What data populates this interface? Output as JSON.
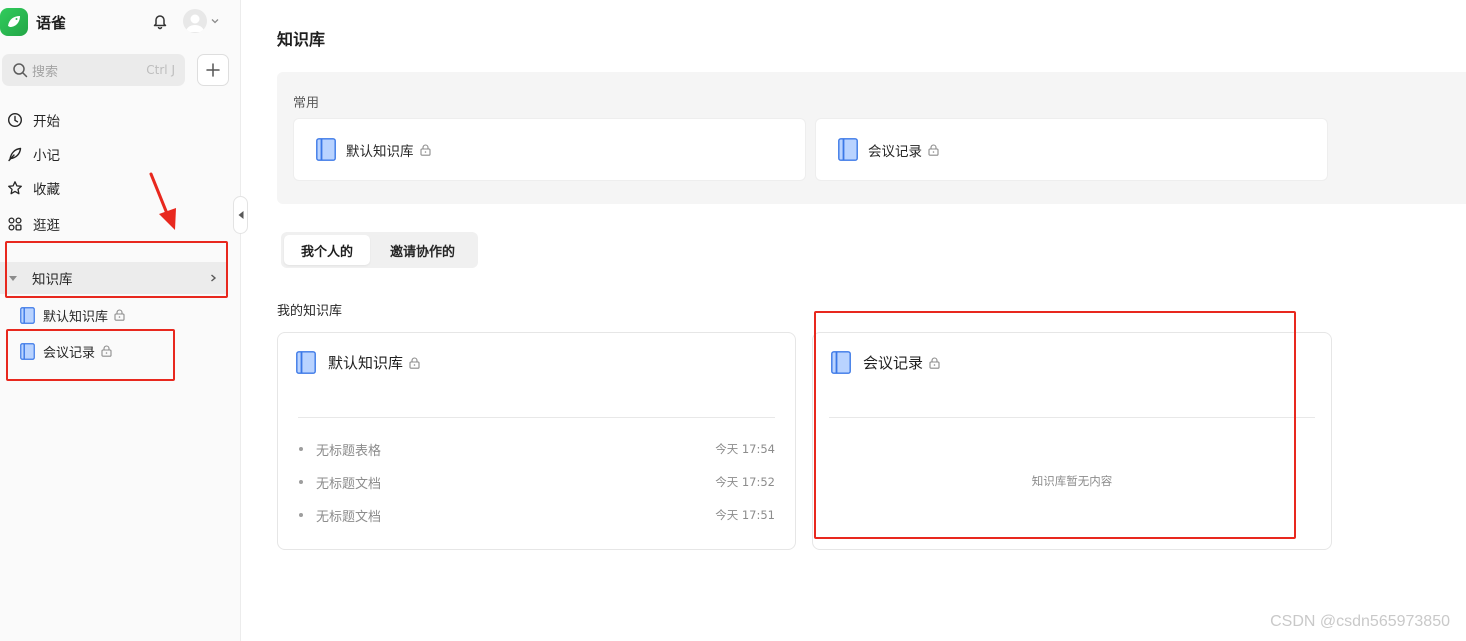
{
  "app": {
    "name": "语雀"
  },
  "search": {
    "placeholder": "搜索",
    "shortcut": "Ctrl J"
  },
  "nav": [
    {
      "label": "开始",
      "icon": "clock-icon"
    },
    {
      "label": "小记",
      "icon": "feather-icon"
    },
    {
      "label": "收藏",
      "icon": "star-icon"
    },
    {
      "label": "逛逛",
      "icon": "grid-icon"
    }
  ],
  "sidebar_kb": {
    "header": "知识库",
    "items": [
      {
        "label": "默认知识库"
      },
      {
        "label": "会议记录"
      }
    ]
  },
  "main": {
    "title": "知识库",
    "common": {
      "label": "常用",
      "cards": [
        {
          "name": "默认知识库"
        },
        {
          "name": "会议记录"
        }
      ]
    },
    "tabs": [
      {
        "label": "我个人的",
        "active": true
      },
      {
        "label": "邀请协作的",
        "active": false
      }
    ],
    "section_title": "我的知识库",
    "kb_cards": [
      {
        "name": "默认知识库",
        "docs": [
          {
            "title": "无标题表格",
            "time": "今天 17:54"
          },
          {
            "title": "无标题文档",
            "time": "今天 17:52"
          },
          {
            "title": "无标题文档",
            "time": "今天 17:51"
          }
        ]
      },
      {
        "name": "会议记录",
        "empty_text": "知识库暂无内容"
      }
    ]
  },
  "watermark": "CSDN @csdn565973850",
  "colors": {
    "brand": "#2fbf56",
    "annotation": "#e8281e",
    "book": "#5b8fe8"
  }
}
